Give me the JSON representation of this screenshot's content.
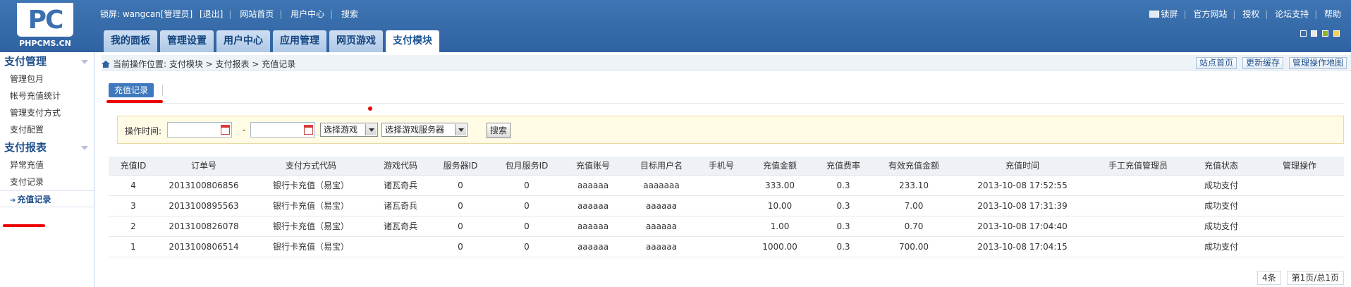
{
  "logo": {
    "text": "PC",
    "subtext": "PHPCMS.CN"
  },
  "topbar": {
    "user": "锁屏: wangcan[管理员]",
    "logout": "[退出]",
    "site_home": "网站首页",
    "user_center": "用户中心",
    "search": "搜索"
  },
  "toprights": {
    "lock": "锁屏",
    "official": "官方网站",
    "license": "授权",
    "forum": "论坛支持",
    "help": "帮助"
  },
  "colors": {
    "swatches": [
      "#3a6fb0",
      "#e9e9e9",
      "#8ab820",
      "#f0d062"
    ]
  },
  "tabs": [
    "我的面板",
    "管理设置",
    "用户中心",
    "应用管理",
    "网页游戏",
    "支付模块"
  ],
  "sidebar": {
    "section1": {
      "title": "支付管理",
      "items": [
        "管理包月",
        "帐号充值统计",
        "管理支付方式",
        "支付配置"
      ]
    },
    "section2": {
      "title": "支付报表",
      "items": [
        "异常充值",
        "支付记录",
        "充值记录"
      ]
    }
  },
  "breadcrumb": "当前操作位置: 支付模块 > 支付报表 > 充值记录",
  "crumb_buttons": [
    "站点首页",
    "更新缓存",
    "管理操作地图"
  ],
  "subtab": "充值记录",
  "filter": {
    "label": "操作时间:",
    "dash": "-",
    "game_select": "选择游戏",
    "server_select": "选择游戏服务器",
    "search_button": "搜索"
  },
  "table": {
    "headers": [
      "充值ID",
      "订单号",
      "支付方式代码",
      "游戏代码",
      "服务器ID",
      "包月服务ID",
      "充值账号",
      "目标用户名",
      "手机号",
      "充值金额",
      "充值费率",
      "有效充值金额",
      "充值时间",
      "手工充值管理员",
      "充值状态",
      "管理操作"
    ],
    "rows": [
      [
        "4",
        "2013100806856",
        "银行卡充值（易宝）",
        "诸瓦奇兵",
        "0",
        "0",
        "aaaaaa",
        "aaaaaaa",
        "",
        "333.00",
        "0.3",
        "233.10",
        "2013-10-08 17:52:55",
        "",
        "成功支付",
        ""
      ],
      [
        "3",
        "2013100895563",
        "银行卡充值（易宝）",
        "诸瓦奇兵",
        "0",
        "0",
        "aaaaaa",
        "aaaaaa",
        "",
        "10.00",
        "0.3",
        "7.00",
        "2013-10-08 17:31:39",
        "",
        "成功支付",
        ""
      ],
      [
        "2",
        "2013100826078",
        "银行卡充值（易宝）",
        "诸瓦奇兵",
        "0",
        "0",
        "aaaaaa",
        "aaaaaa",
        "",
        "1.00",
        "0.3",
        "0.70",
        "2013-10-08 17:04:40",
        "",
        "成功支付",
        ""
      ],
      [
        "1",
        "2013100806514",
        "银行卡充值（易宝）",
        "",
        "0",
        "0",
        "aaaaaa",
        "aaaaaa",
        "",
        "1000.00",
        "0.3",
        "700.00",
        "2013-10-08 17:04:15",
        "",
        "成功支付",
        ""
      ]
    ]
  },
  "pager": {
    "count": "4条",
    "page": "第1页/总1页"
  }
}
